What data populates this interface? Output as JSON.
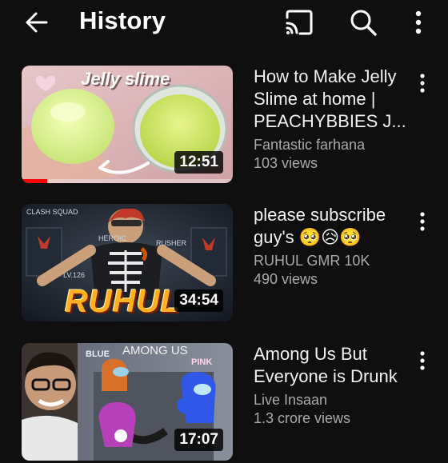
{
  "header": {
    "title": "History",
    "icons": [
      "back-arrow-icon",
      "cast-icon",
      "search-icon",
      "more-vert-icon"
    ]
  },
  "colors": {
    "background": "#0f0f0f",
    "title_text": "#f1f1f1",
    "secondary_text": "#aaaaaa",
    "progress": "#ff0000"
  },
  "videos": [
    {
      "title": "How to Make Jelly Slime at home | PEACHYBBIES J...",
      "channel": "Fantastic farhana",
      "views": "103 views",
      "duration": "12:51",
      "thumb_text": "Jelly slime",
      "watched_fraction": 0.12
    },
    {
      "title": "please subscribe guy's 🥺😥🥺",
      "channel": "RUHUL GMR 10K",
      "views": "490 views",
      "duration": "34:54",
      "thumb_text": "RUHUL",
      "thumb_labels": [
        "CLASH SQUAD",
        "HEROIC",
        "RUSHER",
        "LV.126"
      ]
    },
    {
      "title": "Among Us But Everyone is Drunk",
      "channel": "Live Insaan",
      "views": "1.3 crore views",
      "duration": "17:07",
      "thumb_labels": [
        "BLUE",
        "AMONG US",
        "PINK"
      ]
    }
  ]
}
